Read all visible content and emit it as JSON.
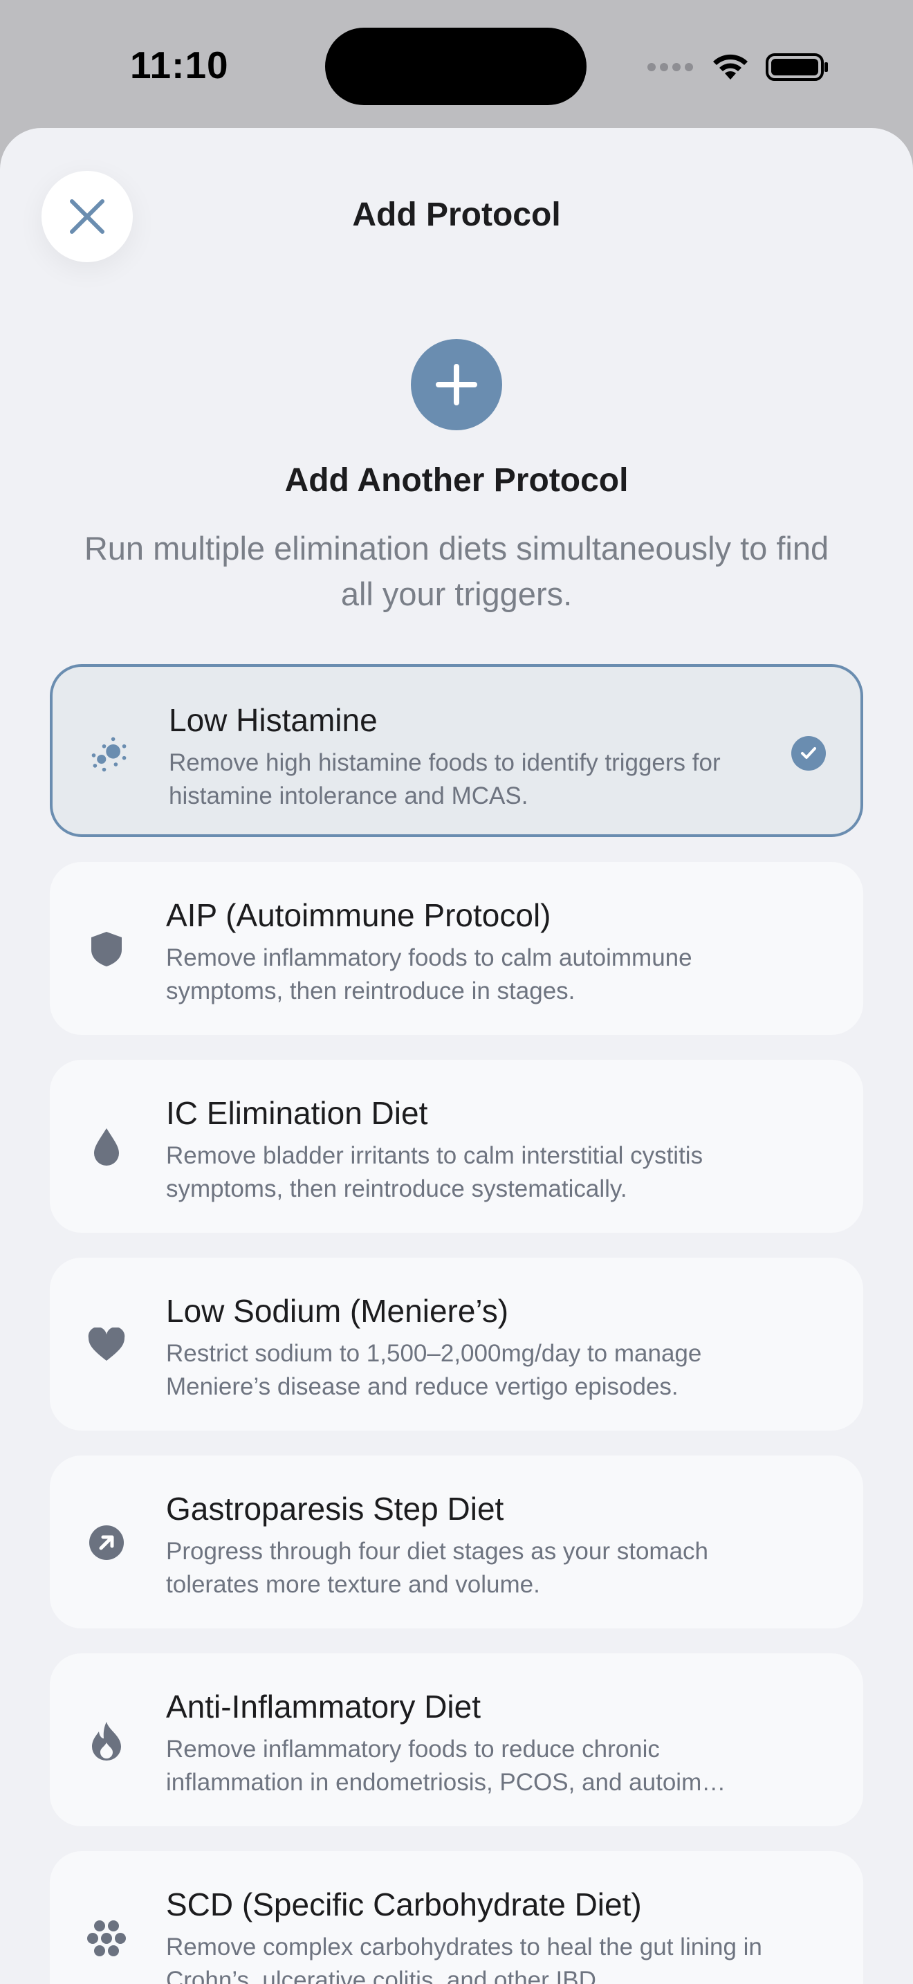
{
  "status_bar": {
    "time": "11:10"
  },
  "header": {
    "title": "Add Protocol",
    "close_icon": "close-icon"
  },
  "hero": {
    "icon": "plus-icon",
    "title": "Add Another Protocol",
    "subtitle": "Run multiple elimination diets simultaneously to find all your triggers."
  },
  "colors": {
    "accent": "#6a8db0",
    "background": "#f0f1f5",
    "card": "#f8f9fb"
  },
  "protocols": [
    {
      "title": "Low Histamine",
      "description": "Remove high histamine foods to identify triggers for histamine intolerance and MCAS.",
      "icon": "sparkle-cells-icon",
      "selected": true
    },
    {
      "title": "AIP (Autoimmune Protocol)",
      "description": "Remove inflammatory foods to calm autoimmune symptoms, then reintroduce in stages.",
      "icon": "shield-icon",
      "selected": false
    },
    {
      "title": "IC Elimination Diet",
      "description": "Remove bladder irritants to calm interstitial cystitis symptoms, then reintroduce systematically.",
      "icon": "drop-icon",
      "selected": false
    },
    {
      "title": "Low Sodium (Meniere’s)",
      "description": "Restrict sodium to 1,500–2,000mg/day to manage Meniere’s disease and reduce vertigo episodes.",
      "icon": "heart-icon",
      "selected": false
    },
    {
      "title": "Gastroparesis Step Diet",
      "description": "Progress through four diet stages as your stomach tolerates more texture and volume.",
      "icon": "arrow-up-right-circle-icon",
      "selected": false
    },
    {
      "title": "Anti-Inflammatory Diet",
      "description": "Remove inflammatory foods to reduce chronic inflammation in endometriosis, PCOS, and autoim…",
      "icon": "flame-icon",
      "selected": false
    },
    {
      "title": "SCD (Specific Carbohydrate Diet)",
      "description": "Remove complex carbohydrates to heal the gut lining in Crohn’s, ulcerative colitis, and other IBD.",
      "icon": "circles-cluster-icon",
      "selected": false
    }
  ]
}
